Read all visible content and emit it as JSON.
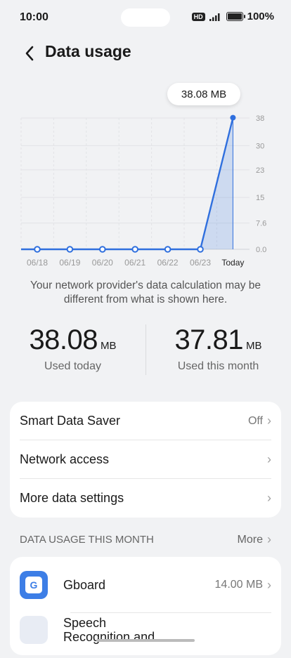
{
  "status": {
    "time": "10:00",
    "hd": "HD",
    "battery": "100%"
  },
  "header": {
    "title": "Data usage"
  },
  "chart_data": {
    "type": "line",
    "categories": [
      "06/18",
      "06/19",
      "06/20",
      "06/21",
      "06/22",
      "06/23",
      "Today"
    ],
    "values": [
      0,
      0,
      0,
      0,
      0,
      0,
      38.08
    ],
    "y_ticks": [
      "38",
      "30",
      "23",
      "15",
      "7.6",
      "0.0"
    ],
    "ylim": [
      0,
      38
    ],
    "grid": true,
    "tooltip": "38.08 MB",
    "color": "#2f6fde"
  },
  "note": "Your network provider's data calculation may be different from what is shown here.",
  "stats": {
    "today": {
      "value": "38.08",
      "unit": "MB",
      "label": "Used today"
    },
    "month": {
      "value": "37.81",
      "unit": "MB",
      "label": "Used this month"
    }
  },
  "settings": {
    "smart_saver": {
      "label": "Smart Data Saver",
      "value": "Off"
    },
    "network_access": {
      "label": "Network access"
    },
    "more_settings": {
      "label": "More data settings"
    }
  },
  "section": {
    "title": "DATA USAGE THIS MONTH",
    "more": "More"
  },
  "apps": [
    {
      "name": "Gboard",
      "usage": "14.00 MB",
      "icon": "G"
    },
    {
      "name": "Speech Recognition and",
      "usage": ""
    }
  ]
}
